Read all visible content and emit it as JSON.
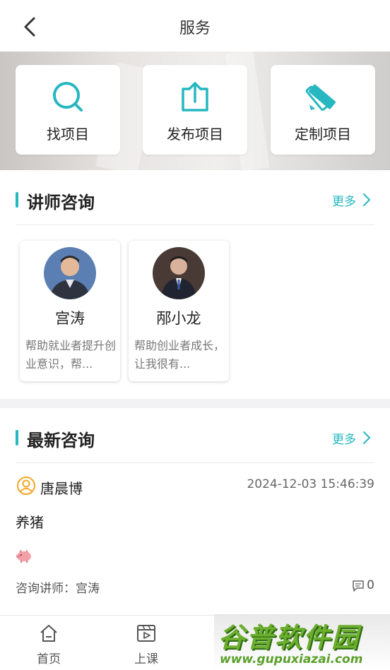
{
  "header": {
    "title": "服务"
  },
  "quick_actions": [
    {
      "label": "找项目",
      "icon": "search-icon"
    },
    {
      "label": "发布项目",
      "icon": "upload-icon"
    },
    {
      "label": "定制项目",
      "icon": "pencil-ruler-icon"
    }
  ],
  "lecturers_section": {
    "title": "讲师咨询",
    "more": "更多",
    "cards": [
      {
        "name": "宫涛",
        "desc": "帮助就业者提升创业意识，帮..."
      },
      {
        "name": "邴小龙",
        "desc": "帮助创业者成长，让我很有..."
      }
    ]
  },
  "latest_section": {
    "title": "最新咨询",
    "more": "更多",
    "item": {
      "user": "唐晨博",
      "time": "2024-12-03 15:46:39",
      "content": "养猪",
      "teacher": "咨询讲师：宫涛",
      "comments": "0"
    }
  },
  "tabbar": [
    {
      "label": "首页",
      "icon": "home-icon"
    },
    {
      "label": "上课",
      "icon": "video-icon"
    }
  ],
  "watermark": {
    "title": "谷普软件园",
    "url": "www.gupuxiazai.com"
  },
  "colors": {
    "accent": "#26b7c1",
    "user_icon": "#f5a623"
  }
}
